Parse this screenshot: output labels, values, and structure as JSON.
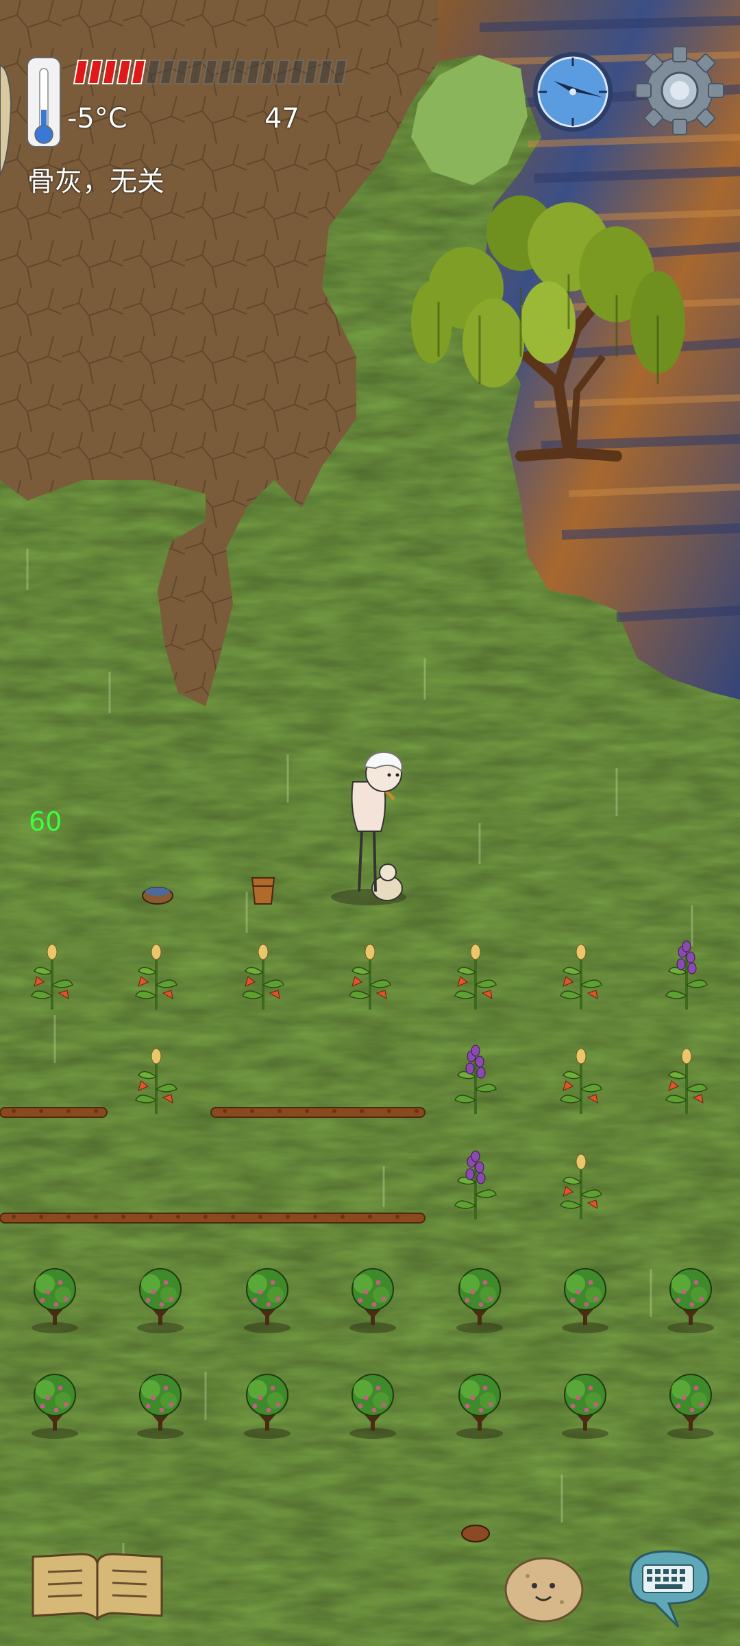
{
  "hud": {
    "temperature": "-5°C",
    "age": "47",
    "status_text": "骨灰，无关",
    "fps": "60",
    "food_pips_filled": 5,
    "food_pips_total": 19
  },
  "icons": {
    "thermometer": "thermometer-icon",
    "compass": "compass-icon",
    "settings": "gear-icon",
    "recipe_book": "book-icon",
    "emote": "potato-face-icon",
    "keyboard": "keyboard-icon"
  },
  "colors": {
    "grass": "#6f9a3f",
    "dirt": "#7a5c3a",
    "water": "#3b4f86",
    "food_red": "#e01818",
    "fps_green": "#3cff3c"
  }
}
